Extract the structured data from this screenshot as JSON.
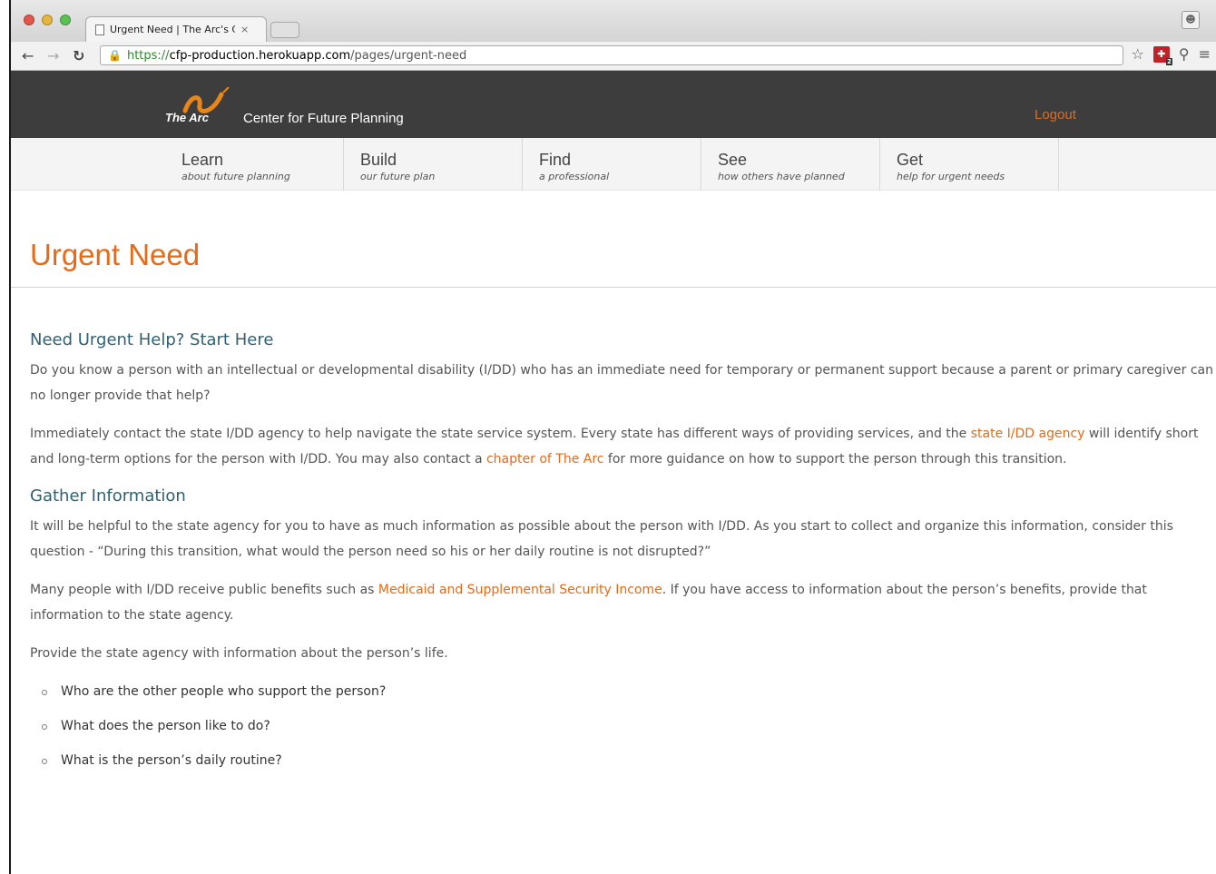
{
  "browser": {
    "tab_title": "Urgent Need | The Arc's C",
    "tab_close": "×",
    "url_scheme": "https://",
    "url_host": "cfp-production.herokuapp.com",
    "url_path": "/pages/urgent-need",
    "ext_badge": "2"
  },
  "site": {
    "logo_text": "The Arc",
    "title": "Center for Future Planning",
    "logout": "Logout",
    "brand_color": "#e66a17"
  },
  "nav": [
    {
      "label": "Learn",
      "sub": "about future planning"
    },
    {
      "label": "Build",
      "sub": "our future plan"
    },
    {
      "label": "Find",
      "sub": "a professional"
    },
    {
      "label": "See",
      "sub": "how others have planned"
    },
    {
      "label": "Get",
      "sub": "help for urgent needs"
    }
  ],
  "page": {
    "title": "Urgent Need",
    "s1_heading": "Need Urgent Help? Start Here",
    "s1_p1": "Do you know a person with an intellectual or developmental disability (I/DD) who has an immediate need for temporary or permanent support because a parent or primary caregiver can no longer provide that help?",
    "s1_p2_a": "Immediately contact the state I/DD agency to help navigate the state service system. Every state has different ways of providing services, and the ",
    "s1_p2_link1": "state I/DD agency",
    "s1_p2_b": " will identify short and long-term options for the person with I/DD. You may also contact a ",
    "s1_p2_link2": "chapter of The Arc",
    "s1_p2_c": " for more guidance on how to support the person through this transition.",
    "s2_heading": "Gather Information",
    "s2_p1": "It will be helpful to the state agency for you to have as much information as possible about the person with I/DD. As you start to collect and organize this information, consider this question - “During this transition, what would the person need so his or her daily routine is not disrupted?”",
    "s2_p2_a": "Many people with I/DD receive public benefits such as ",
    "s2_p2_link": "Medicaid and Supplemental Security Income",
    "s2_p2_b": ". If you have access to information about the person’s benefits, provide that information to the state agency.",
    "s2_p3": "Provide the state agency with information about the person’s life.",
    "bullets": [
      "Who are the other people who support the person?",
      "What does the person like to do?",
      "What is the person’s daily routine?"
    ]
  }
}
